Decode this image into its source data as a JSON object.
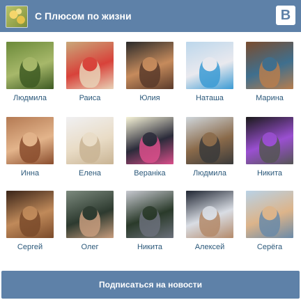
{
  "header": {
    "group_name": "С Плюсом по жизни",
    "logo_letter": "В"
  },
  "members": [
    {
      "name": "Людмила",
      "colors": [
        "#6b8a3a",
        "#a7b86a",
        "#3d5a22"
      ]
    },
    {
      "name": "Раиса",
      "colors": [
        "#c9a87a",
        "#d8423a",
        "#e8d1b6"
      ]
    },
    {
      "name": "Юлия",
      "colors": [
        "#2a2a2a",
        "#c68b5c",
        "#5a3a2a"
      ]
    },
    {
      "name": "Наташа",
      "colors": [
        "#bcd7ec",
        "#e9e9ee",
        "#3b9bd4"
      ]
    },
    {
      "name": "Марина",
      "colors": [
        "#7a4c2e",
        "#3f6f8e",
        "#b77d4d"
      ]
    },
    {
      "name": "Инна",
      "colors": [
        "#b47a53",
        "#e3b48b",
        "#8a4d2d"
      ]
    },
    {
      "name": "Елена",
      "colors": [
        "#f0f0f2",
        "#e9dcc6",
        "#c9b494"
      ]
    },
    {
      "name": "Вераніка",
      "colors": [
        "#f6f3d7",
        "#2b2b3a",
        "#d94e8a"
      ]
    },
    {
      "name": "Людмила",
      "colors": [
        "#cfd6db",
        "#8a6a4a",
        "#3a3a3a"
      ]
    },
    {
      "name": "Никита",
      "colors": [
        "#1a1a1a",
        "#9a4fd1",
        "#555555"
      ]
    },
    {
      "name": "Сергей",
      "colors": [
        "#3a2418",
        "#c08a5a",
        "#7a4a2a"
      ]
    },
    {
      "name": "Олег",
      "colors": [
        "#7c8a7e",
        "#2d3a2f",
        "#c79c7d"
      ]
    },
    {
      "name": "Никита",
      "colors": [
        "#c7c9d0",
        "#2a3a2a",
        "#6a6f7a"
      ]
    },
    {
      "name": "Алексей",
      "colors": [
        "#1f2532",
        "#d9dde4",
        "#b48a6a"
      ]
    },
    {
      "name": "Серёга",
      "colors": [
        "#b9d2e6",
        "#dcb48a",
        "#6a8aa8"
      ]
    }
  ],
  "subscribe_button": {
    "label": "Подписаться на новости"
  },
  "colors": {
    "header_bg": "#5e81a8",
    "link": "#2b587a",
    "button_bg": "#5e81a8"
  }
}
